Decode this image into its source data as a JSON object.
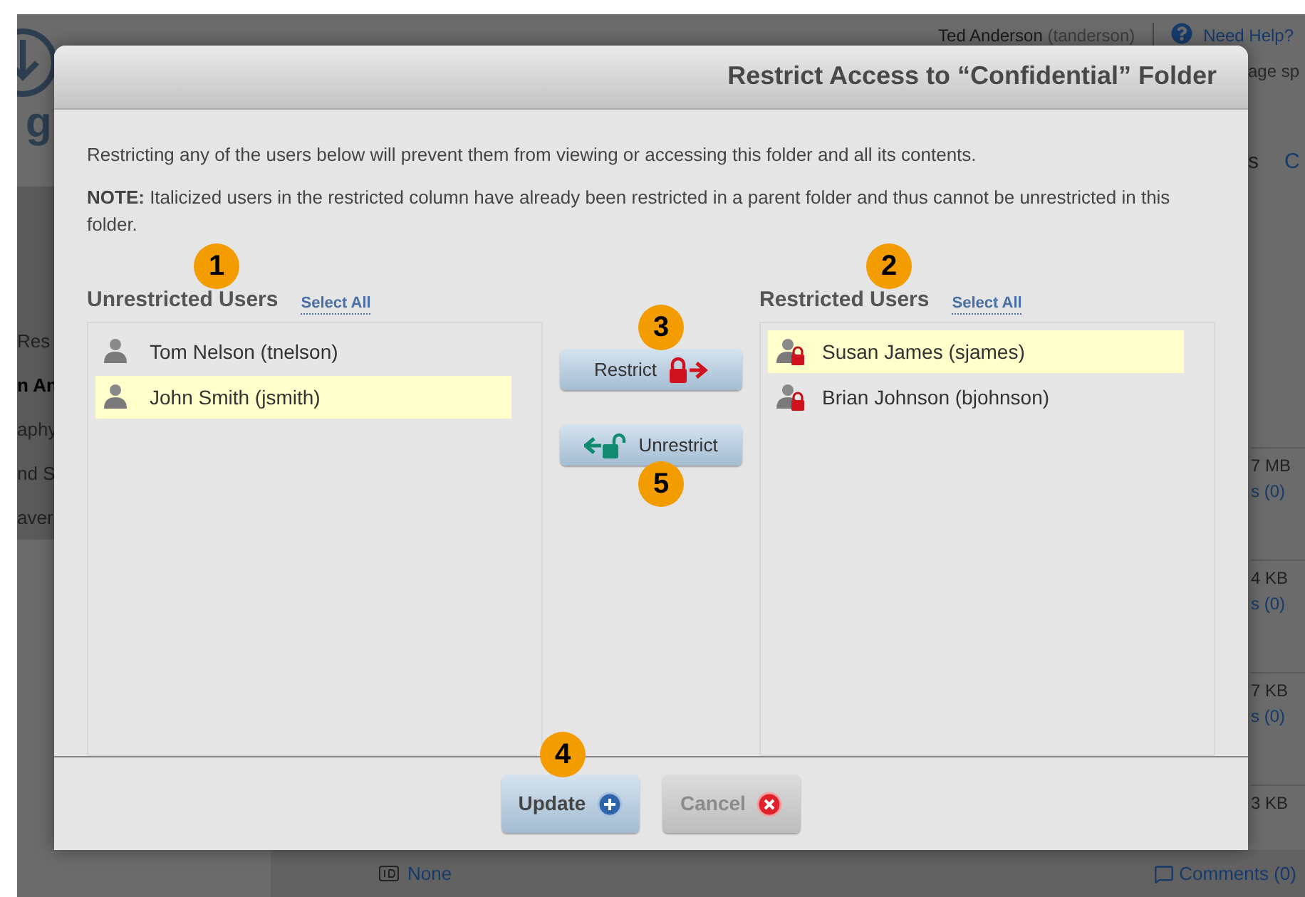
{
  "background": {
    "user_name": "Ted Anderson",
    "user_login": "(tanderson)",
    "help_link": "Need Help?",
    "header_fragment": "age sp",
    "logo_fragment": "g",
    "tab_fragments": [
      "s",
      "C"
    ],
    "sidebar_fragments": [
      "Res",
      "n An",
      "aphy",
      "nd S",
      "aver"
    ],
    "file_rows": [
      {
        "size": "7 MB",
        "comments": "s (0)"
      },
      {
        "size": "4 KB",
        "comments": "s (0)"
      },
      {
        "size": "7 KB",
        "comments": "s (0)"
      },
      {
        "size": "3 KB",
        "comments": ""
      }
    ],
    "bottom_id": "None",
    "bottom_comments": "Comments (0)"
  },
  "dialog": {
    "title": "Restrict Access to “Confidential” Folder",
    "intro": "Restricting any of the users below will prevent them from viewing or accessing this folder and all its contents.",
    "note": "**NOTE:** Italicized users in the restricted column have already been restricted in a parent folder and thus cannot be unrestricted in this folder.",
    "columns": [
      {
        "kind": "unrestricted",
        "title": "Unrestricted Users",
        "select_all": "Select All",
        "callout": "1",
        "users": [
          {
            "name": "Tom Nelson (tnelson)",
            "selected": false
          },
          {
            "name": "John Smith (jsmith)",
            "selected": true
          }
        ]
      },
      {
        "kind": "restricted",
        "title": "Restricted Users",
        "select_all": "Select All",
        "callout": "2",
        "users": [
          {
            "name": "Susan James (sjames)",
            "selected": true
          },
          {
            "name": "Brian Johnson (bjohnson)",
            "selected": false
          }
        ]
      }
    ],
    "move_buttons": [
      {
        "kind": "restrict",
        "label": "Restrict",
        "callout": "3"
      },
      {
        "kind": "unrestrict",
        "label": "Unrestrict",
        "callout": "5"
      }
    ],
    "footer_buttons": [
      {
        "kind": "update",
        "label": "Update",
        "disabled": false,
        "callout": "4"
      },
      {
        "kind": "cancel",
        "label": "Cancel",
        "disabled": true
      }
    ]
  }
}
